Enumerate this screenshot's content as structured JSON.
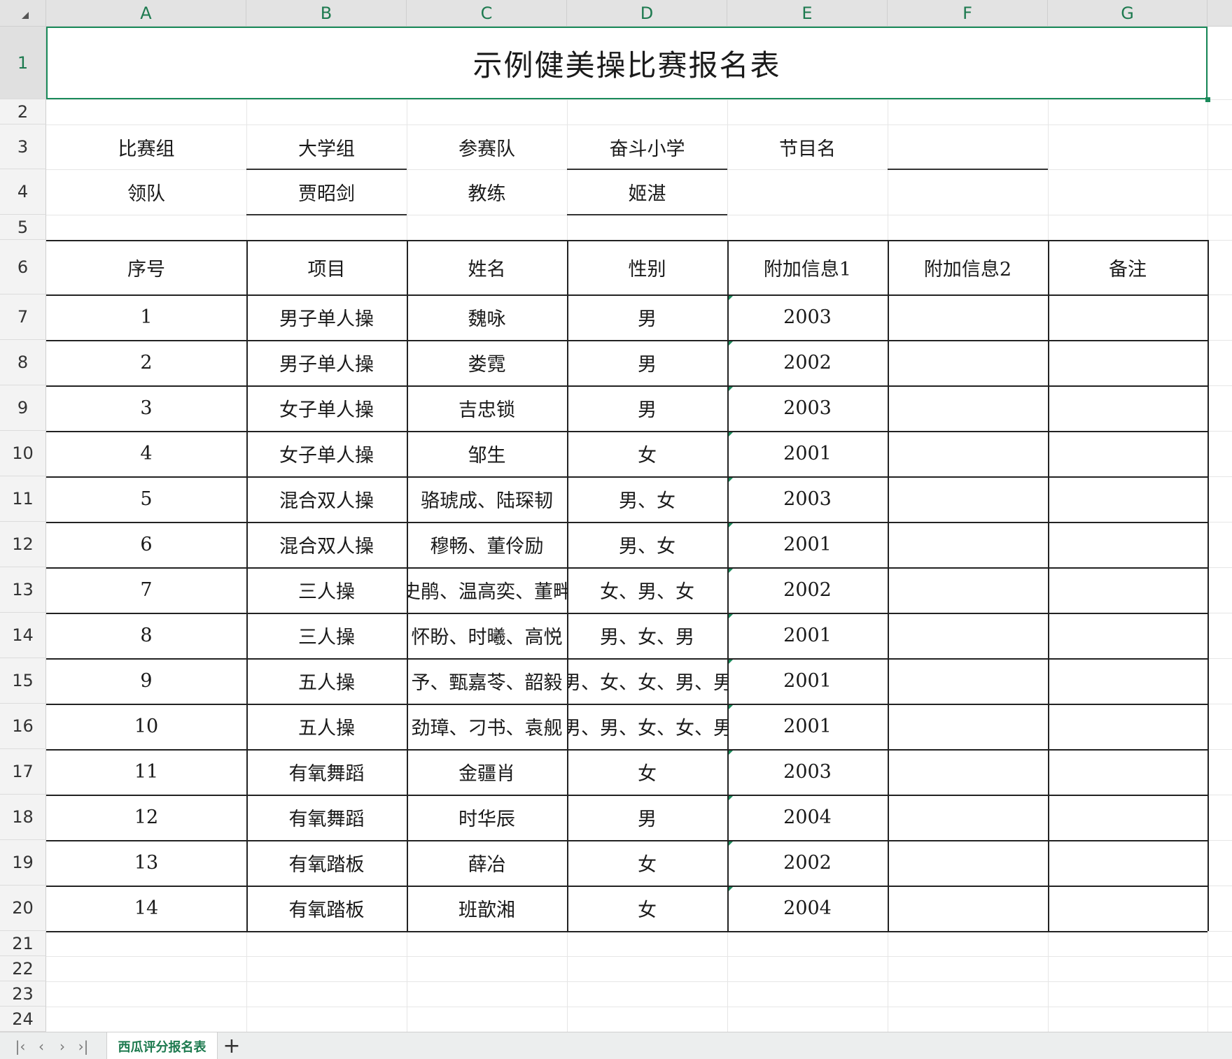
{
  "grid": {
    "columns": [
      "A",
      "B",
      "C",
      "D",
      "E",
      "F",
      "G"
    ],
    "rows": [
      "1",
      "2",
      "3",
      "4",
      "5",
      "6",
      "7",
      "8",
      "9",
      "10",
      "11",
      "12",
      "13",
      "14",
      "15",
      "16",
      "17",
      "18",
      "19",
      "20",
      "21",
      "22",
      "23",
      "24"
    ],
    "active_row": "1"
  },
  "title": "示例健美操比赛报名表",
  "info": {
    "row3": [
      "比赛组",
      "大学组",
      "参赛队",
      "奋斗小学",
      "节目名",
      "",
      ""
    ],
    "row4": [
      "领队",
      "贾昭剑",
      "教练",
      "姬湛",
      "",
      "",
      ""
    ]
  },
  "table": {
    "headers": [
      "序号",
      "项目",
      "姓名",
      "性别",
      "附加信息1",
      "附加信息2",
      "备注"
    ],
    "rows": [
      [
        "1",
        "男子单人操",
        "魏咏",
        "男",
        "2003",
        "",
        ""
      ],
      [
        "2",
        "男子单人操",
        "娄霓",
        "男",
        "2002",
        "",
        ""
      ],
      [
        "3",
        "女子单人操",
        "吉忠锁",
        "男",
        "2003",
        "",
        ""
      ],
      [
        "4",
        "女子单人操",
        "邹生",
        "女",
        "2001",
        "",
        ""
      ],
      [
        "5",
        "混合双人操",
        "骆琥成、陆琛韧",
        "男、女",
        "2003",
        "",
        ""
      ],
      [
        "6",
        "混合双人操",
        "穆畅、董伶励",
        "男、女",
        "2001",
        "",
        ""
      ],
      [
        "7",
        "三人操",
        "史鹃、温高奕、董畔",
        "女、男、女",
        "2002",
        "",
        ""
      ],
      [
        "8",
        "三人操",
        "怀盼、时曦、高悦",
        "男、女、男",
        "2001",
        "",
        ""
      ],
      [
        "9",
        "五人操",
        "予、甄嘉苓、韶毅",
        "男、女、女、男、男",
        "2001",
        "",
        ""
      ],
      [
        "10",
        "五人操",
        "劲璋、刁书、袁舰",
        "男、男、女、女、男",
        "2001",
        "",
        ""
      ],
      [
        "11",
        "有氧舞蹈",
        "金疆肖",
        "女",
        "2003",
        "",
        ""
      ],
      [
        "12",
        "有氧舞蹈",
        "时华辰",
        "男",
        "2004",
        "",
        ""
      ],
      [
        "13",
        "有氧踏板",
        "薛冶",
        "女",
        "2002",
        "",
        ""
      ],
      [
        "14",
        "有氧踏板",
        "班歆湘",
        "女",
        "2004",
        "",
        ""
      ]
    ]
  },
  "tabs": {
    "sheet_name": "西瓜评分报名表",
    "add_label": "+",
    "nav": [
      "|‹",
      "‹",
      "›",
      "›|"
    ]
  },
  "colors": {
    "accent": "#1a8a5a",
    "header_bg": "#e3e3e3",
    "grid_line": "#e6e6e6"
  }
}
